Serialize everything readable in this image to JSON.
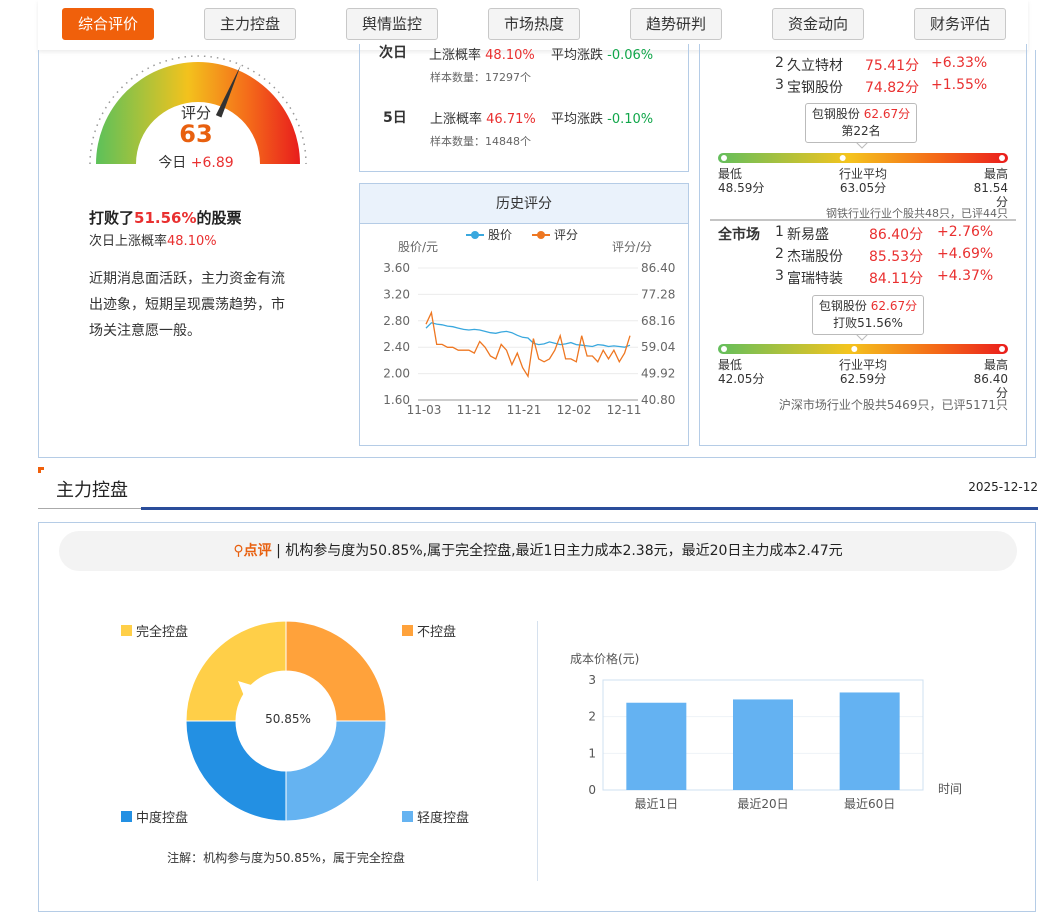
{
  "tabs": [
    "综合评价",
    "主力控盘",
    "舆情监控",
    "市场热度",
    "趋势研判",
    "资金动向",
    "财务评估"
  ],
  "gauge": {
    "label": "评分",
    "score": "63",
    "today_label": "今日",
    "today_change": "+6.89",
    "needle_fraction": 0.63
  },
  "summary": {
    "beat_prefix": "打败了",
    "beat_pct": "51.56%",
    "beat_suffix": "的股票",
    "next_prefix": "次日上涨概率",
    "next_pct": "48.10%",
    "comment": "近期消息面活跃，主力资金有流出迹象，短期呈现震荡趋势，市场关注意愿一般。"
  },
  "prob": {
    "rows": [
      {
        "period": "次日",
        "up_label": "上涨概率",
        "up_value": "48.10%",
        "avg_label": "平均涨跌",
        "avg_value": "-0.06%",
        "sample_label": "样本数量：",
        "sample_value": "17297个"
      },
      {
        "period": "5日",
        "up_label": "上涨概率",
        "up_value": "46.71%",
        "avg_label": "平均涨跌",
        "avg_value": "-0.10%",
        "sample_label": "样本数量：",
        "sample_value": "14848个"
      }
    ]
  },
  "history": {
    "title": "历史评分",
    "legend_price": "股价",
    "legend_score": "评分",
    "left_unit": "股价/元",
    "right_unit": "评分/分",
    "left_ticks": [
      "3.60",
      "3.20",
      "2.80",
      "2.40",
      "2.00",
      "1.60"
    ],
    "right_ticks": [
      "86.40",
      "77.28",
      "68.16",
      "59.04",
      "49.92",
      "40.80"
    ],
    "x_ticks": [
      "11-03",
      "11-12",
      "11-21",
      "12-02",
      "12-11"
    ],
    "colors": {
      "price": "#3aa8de",
      "score": "#ee7722"
    }
  },
  "chart_data": [
    {
      "type": "line",
      "title": "历史评分",
      "x_ticks": [
        "11-03",
        "11-12",
        "11-21",
        "12-02",
        "12-11"
      ],
      "y_left_range": [
        1.6,
        3.6
      ],
      "y_right_range": [
        40.8,
        86.4
      ],
      "ylabel_left": "股价/元",
      "ylabel_right": "评分/分",
      "series": [
        {
          "name": "股价",
          "axis": "left",
          "values": [
            2.69,
            2.77,
            2.75,
            2.74,
            2.72,
            2.71,
            2.69,
            2.67,
            2.66,
            2.67,
            2.66,
            2.64,
            2.62,
            2.61,
            2.63,
            2.64,
            2.62,
            2.58,
            2.55,
            2.54,
            2.46,
            2.44,
            2.45,
            2.48,
            2.46,
            2.44,
            2.45,
            2.47,
            2.44,
            2.43,
            2.42,
            2.41,
            2.44,
            2.43,
            2.41,
            2.42,
            2.41,
            2.4,
            2.43
          ]
        },
        {
          "name": "评分",
          "axis": "right",
          "values": [
            67,
            71,
            60,
            60,
            59,
            59,
            58,
            58,
            58,
            57,
            61,
            59,
            56,
            55,
            60,
            58,
            53,
            57,
            52,
            49,
            62,
            55,
            54,
            55,
            58,
            63,
            55,
            55,
            54,
            63,
            56,
            56,
            54,
            58,
            55,
            58,
            54,
            57,
            63
          ]
        }
      ]
    },
    {
      "type": "pie",
      "center_label": "50.85%",
      "slices": [
        {
          "name": "不控盘",
          "value": 25
        },
        {
          "name": "轻度控盘",
          "value": 25
        },
        {
          "name": "中度控盘",
          "value": 25
        },
        {
          "name": "完全控盘",
          "value": 25
        }
      ],
      "colors": [
        "#ffa23b",
        "#65b3f1",
        "#2390e3",
        "#ffcf48"
      ]
    },
    {
      "type": "bar",
      "ylabel": "成本价格(元)",
      "xlabel": "时间",
      "categories": [
        "最近1日",
        "最近20日",
        "最近60日"
      ],
      "values": [
        2.38,
        2.47,
        2.66
      ],
      "ylim": [
        0,
        3
      ],
      "y_ticks": [
        "3",
        "2",
        "1",
        "0"
      ],
      "color": "#64b2f2"
    }
  ],
  "industry": {
    "items": [
      {
        "rank": "2",
        "name": "久立特材",
        "score": "75.41分",
        "change": "+6.33%"
      },
      {
        "rank": "3",
        "name": "宝钢股份",
        "score": "74.82分",
        "change": "+1.55%"
      }
    ],
    "bubble_line1_name": "包钢股份",
    "bubble_line1_score": "62.67分",
    "bubble_line2": "第22名",
    "low_label": "最低",
    "low_value": "48.59分",
    "avg_label": "行业平均",
    "avg_value": "63.05分",
    "high_label": "最高",
    "high_value": "81.54分",
    "marker_fraction": 0.43,
    "footnote": "钢铁行业行业个股共48只，已评44只"
  },
  "market": {
    "title": "全市场",
    "items": [
      {
        "rank": "1",
        "name": "新易盛",
        "score": "86.40分",
        "change": "+2.76%"
      },
      {
        "rank": "2",
        "name": "杰瑞股份",
        "score": "85.53分",
        "change": "+4.69%"
      },
      {
        "rank": "3",
        "name": "富瑞特装",
        "score": "84.11分",
        "change": "+4.37%"
      }
    ],
    "bubble_line1_name": "包钢股份",
    "bubble_line1_score": "62.67分",
    "bubble_line2": "打败51.56%",
    "low_label": "最低",
    "low_value": "42.05分",
    "avg_label": "行业平均",
    "avg_value": "62.59分",
    "high_label": "最高",
    "high_value": "86.40分",
    "marker_fraction": 0.47,
    "footnote": "沪深市场行业个股共5469只，已评5171只"
  },
  "section": {
    "title": "主力控盘",
    "date": "2025-12-12",
    "comment_label": "点评",
    "comment_text": "| 机构参与度为50.85%,属于完全控盘,最近1日主力成本2.38元，最近20日主力成本2.47元",
    "pie_note": "注解：机构参与度为50.85%，属于完全控盘",
    "legend": [
      "完全控盘",
      "不控盘",
      "中度控盘",
      "轻度控盘"
    ]
  }
}
